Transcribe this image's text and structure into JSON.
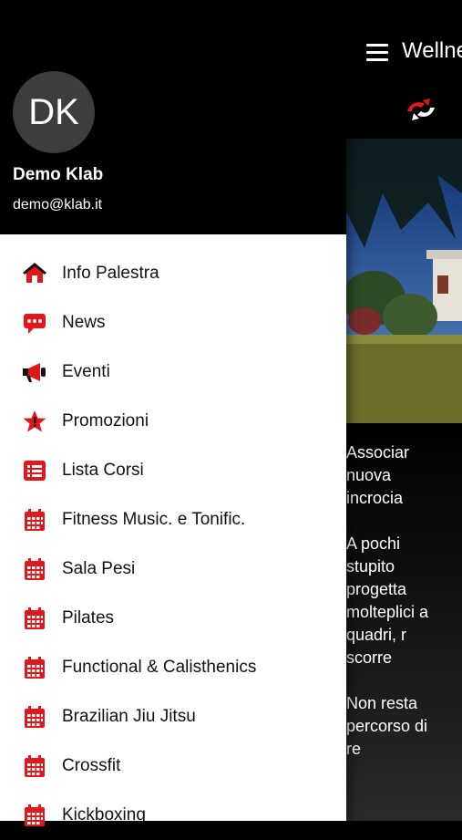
{
  "app": {
    "title": "Wellne",
    "colors": {
      "accent": "#e3161b",
      "drawer_header": "#000000",
      "avatar_bg": "#3d3d3d"
    }
  },
  "user": {
    "initials": "DK",
    "name": "Demo Klab",
    "email": "demo@klab.it"
  },
  "menu": [
    {
      "label": "Info Palestra",
      "icon": "home-icon"
    },
    {
      "label": "News",
      "icon": "chat-icon"
    },
    {
      "label": "Eventi",
      "icon": "megaphone-icon"
    },
    {
      "label": "Promozioni",
      "icon": "star-icon"
    },
    {
      "label": "Lista Corsi",
      "icon": "list-icon"
    },
    {
      "label": "Fitness Music. e Tonific.",
      "icon": "calendar-icon"
    },
    {
      "label": "Sala Pesi",
      "icon": "calendar-icon"
    },
    {
      "label": "Pilates",
      "icon": "calendar-icon"
    },
    {
      "label": "Functional & Calisthenics",
      "icon": "calendar-icon"
    },
    {
      "label": "Brazilian Jiu Jitsu",
      "icon": "calendar-icon"
    },
    {
      "label": "Crossfit",
      "icon": "calendar-icon"
    },
    {
      "label": "Kickboxing",
      "icon": "calendar-icon"
    }
  ],
  "content": {
    "intro_lines": [
      "Associar",
      "nuova",
      "incrocia",
      "",
      "A pochi",
      "stupito",
      "progetta",
      "molteplici a",
      "quadri, r",
      "scorre",
      "",
      "Non resta",
      "percorso di",
      "re"
    ]
  }
}
